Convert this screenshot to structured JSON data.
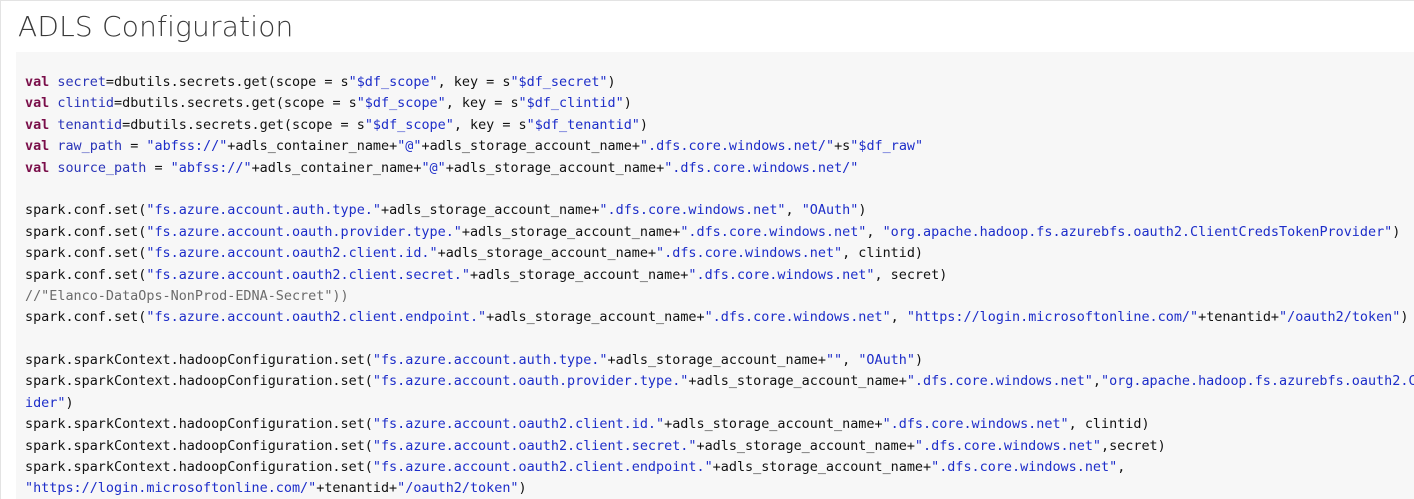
{
  "page": {
    "title": "ADLS Configuration"
  },
  "code": {
    "lines": [
      [
        {
          "t": "kw",
          "v": "val"
        },
        {
          "t": "pl",
          "v": " "
        },
        {
          "t": "id",
          "v": "secret"
        },
        {
          "t": "pl",
          "v": "=dbutils.secrets.get(scope = s"
        },
        {
          "t": "str",
          "v": "\"$df_scope\""
        },
        {
          "t": "pl",
          "v": ", key = s"
        },
        {
          "t": "str",
          "v": "\"$df_secret\""
        },
        {
          "t": "pl",
          "v": ")"
        }
      ],
      [
        {
          "t": "kw",
          "v": "val"
        },
        {
          "t": "pl",
          "v": " "
        },
        {
          "t": "id",
          "v": "clintid"
        },
        {
          "t": "pl",
          "v": "=dbutils.secrets.get(scope = s"
        },
        {
          "t": "str",
          "v": "\"$df_scope\""
        },
        {
          "t": "pl",
          "v": ", key = s"
        },
        {
          "t": "str",
          "v": "\"$df_clintid\""
        },
        {
          "t": "pl",
          "v": ")"
        }
      ],
      [
        {
          "t": "kw",
          "v": "val"
        },
        {
          "t": "pl",
          "v": " "
        },
        {
          "t": "id",
          "v": "tenantid"
        },
        {
          "t": "pl",
          "v": "=dbutils.secrets.get(scope = s"
        },
        {
          "t": "str",
          "v": "\"$df_scope\""
        },
        {
          "t": "pl",
          "v": ", key = s"
        },
        {
          "t": "str",
          "v": "\"$df_tenantid\""
        },
        {
          "t": "pl",
          "v": ")"
        }
      ],
      [
        {
          "t": "kw",
          "v": "val"
        },
        {
          "t": "pl",
          "v": " "
        },
        {
          "t": "id",
          "v": "raw_path"
        },
        {
          "t": "pl",
          "v": " = "
        },
        {
          "t": "str",
          "v": "\"abfss://\""
        },
        {
          "t": "pl",
          "v": "+adls_container_name+"
        },
        {
          "t": "str",
          "v": "\"@\""
        },
        {
          "t": "pl",
          "v": "+adls_storage_account_name+"
        },
        {
          "t": "str",
          "v": "\".dfs.core.windows.net/\""
        },
        {
          "t": "pl",
          "v": "+s"
        },
        {
          "t": "str",
          "v": "\"$df_raw\""
        }
      ],
      [
        {
          "t": "kw",
          "v": "val"
        },
        {
          "t": "pl",
          "v": " "
        },
        {
          "t": "id",
          "v": "source_path"
        },
        {
          "t": "pl",
          "v": " = "
        },
        {
          "t": "str",
          "v": "\"abfss://\""
        },
        {
          "t": "pl",
          "v": "+adls_container_name+"
        },
        {
          "t": "str",
          "v": "\"@\""
        },
        {
          "t": "pl",
          "v": "+adls_storage_account_name+"
        },
        {
          "t": "str",
          "v": "\".dfs.core.windows.net/\""
        }
      ],
      [],
      [
        {
          "t": "pl",
          "v": "spark.conf.set("
        },
        {
          "t": "str",
          "v": "\"fs.azure.account.auth.type.\""
        },
        {
          "t": "pl",
          "v": "+adls_storage_account_name+"
        },
        {
          "t": "str",
          "v": "\".dfs.core.windows.net\""
        },
        {
          "t": "pl",
          "v": ", "
        },
        {
          "t": "str",
          "v": "\"OAuth\""
        },
        {
          "t": "pl",
          "v": ")"
        }
      ],
      [
        {
          "t": "pl",
          "v": "spark.conf.set("
        },
        {
          "t": "str",
          "v": "\"fs.azure.account.oauth.provider.type.\""
        },
        {
          "t": "pl",
          "v": "+adls_storage_account_name+"
        },
        {
          "t": "str",
          "v": "\".dfs.core.windows.net\""
        },
        {
          "t": "pl",
          "v": ", "
        },
        {
          "t": "str",
          "v": "\"org.apache.hadoop.fs.azurebfs.oauth2.ClientCredsTokenProvider\""
        },
        {
          "t": "pl",
          "v": ")"
        }
      ],
      [
        {
          "t": "pl",
          "v": "spark.conf.set("
        },
        {
          "t": "str",
          "v": "\"fs.azure.account.oauth2.client.id.\""
        },
        {
          "t": "pl",
          "v": "+adls_storage_account_name+"
        },
        {
          "t": "str",
          "v": "\".dfs.core.windows.net\""
        },
        {
          "t": "pl",
          "v": ", clintid)"
        }
      ],
      [
        {
          "t": "pl",
          "v": "spark.conf.set("
        },
        {
          "t": "str",
          "v": "\"fs.azure.account.oauth2.client.secret.\""
        },
        {
          "t": "pl",
          "v": "+adls_storage_account_name+"
        },
        {
          "t": "str",
          "v": "\".dfs.core.windows.net\""
        },
        {
          "t": "pl",
          "v": ", secret)"
        }
      ],
      [
        {
          "t": "cm",
          "v": "//\"Elanco-DataOps-NonProd-EDNA-Secret\"))"
        }
      ],
      [
        {
          "t": "pl",
          "v": "spark.conf.set("
        },
        {
          "t": "str",
          "v": "\"fs.azure.account.oauth2.client.endpoint.\""
        },
        {
          "t": "pl",
          "v": "+adls_storage_account_name+"
        },
        {
          "t": "str",
          "v": "\".dfs.core.windows.net\""
        },
        {
          "t": "pl",
          "v": ", "
        },
        {
          "t": "str",
          "v": "\"https://login.microsoftonline.com/\""
        },
        {
          "t": "pl",
          "v": "+tenantid+"
        },
        {
          "t": "str",
          "v": "\"/oauth2/token\""
        },
        {
          "t": "pl",
          "v": ")"
        }
      ],
      [],
      [
        {
          "t": "pl",
          "v": "spark.sparkContext.hadoopConfiguration.set("
        },
        {
          "t": "str",
          "v": "\"fs.azure.account.auth.type.\""
        },
        {
          "t": "pl",
          "v": "+adls_storage_account_name+"
        },
        {
          "t": "str",
          "v": "\"\""
        },
        {
          "t": "pl",
          "v": ", "
        },
        {
          "t": "str",
          "v": "\"OAuth\""
        },
        {
          "t": "pl",
          "v": ")"
        }
      ],
      [
        {
          "t": "pl",
          "v": "spark.sparkContext.hadoopConfiguration.set("
        },
        {
          "t": "str",
          "v": "\"fs.azure.account.oauth.provider.type.\""
        },
        {
          "t": "pl",
          "v": "+adls_storage_account_name+"
        },
        {
          "t": "str",
          "v": "\".dfs.core.windows.net\""
        },
        {
          "t": "pl",
          "v": ","
        },
        {
          "t": "str",
          "v": "\"org.apache.hadoop.fs.azurebfs.oauth2.ClientCredsTokenProv"
        }
      ],
      [
        {
          "t": "str",
          "v": "ider\""
        },
        {
          "t": "pl",
          "v": ")"
        }
      ],
      [
        {
          "t": "pl",
          "v": "spark.sparkContext.hadoopConfiguration.set("
        },
        {
          "t": "str",
          "v": "\"fs.azure.account.oauth2.client.id.\""
        },
        {
          "t": "pl",
          "v": "+adls_storage_account_name+"
        },
        {
          "t": "str",
          "v": "\".dfs.core.windows.net\""
        },
        {
          "t": "pl",
          "v": ", clintid)"
        }
      ],
      [
        {
          "t": "pl",
          "v": "spark.sparkContext.hadoopConfiguration.set("
        },
        {
          "t": "str",
          "v": "\"fs.azure.account.oauth2.client.secret.\""
        },
        {
          "t": "pl",
          "v": "+adls_storage_account_name+"
        },
        {
          "t": "str",
          "v": "\".dfs.core.windows.net\""
        },
        {
          "t": "pl",
          "v": ",secret)"
        }
      ],
      [
        {
          "t": "pl",
          "v": "spark.sparkContext.hadoopConfiguration.set("
        },
        {
          "t": "str",
          "v": "\"fs.azure.account.oauth2.client.endpoint.\""
        },
        {
          "t": "pl",
          "v": "+adls_storage_account_name+"
        },
        {
          "t": "str",
          "v": "\".dfs.core.windows.net\""
        },
        {
          "t": "pl",
          "v": ","
        }
      ],
      [
        {
          "t": "str",
          "v": "\"https://login.microsoftonline.com/\""
        },
        {
          "t": "pl",
          "v": "+tenantid+"
        },
        {
          "t": "str",
          "v": "\"/oauth2/token\""
        },
        {
          "t": "pl",
          "v": ")"
        }
      ]
    ]
  }
}
